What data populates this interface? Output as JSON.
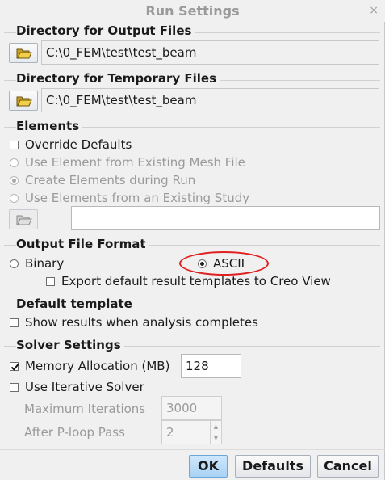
{
  "window": {
    "title": "Run Settings",
    "close_glyph": "×"
  },
  "output_dir": {
    "group_title": "Directory for Output Files",
    "path": "C:\\0_FEM\\test\\test_beam",
    "icon": "folder-open-icon"
  },
  "temp_dir": {
    "group_title": "Directory for Temporary Files",
    "path": "C:\\0_FEM\\test\\test_beam",
    "icon": "folder-open-icon"
  },
  "elements": {
    "group_title": "Elements",
    "override_defaults": {
      "label": "Override Defaults",
      "checked": false
    },
    "options": [
      {
        "label": "Use Element from Existing Mesh File",
        "selected": false,
        "enabled": false
      },
      {
        "label": "Create Elements during Run",
        "selected": true,
        "enabled": false
      },
      {
        "label": "Use Elements from an Existing Study",
        "selected": false,
        "enabled": false
      }
    ],
    "study_path": ""
  },
  "output_format": {
    "group_title": "Output File Format",
    "binary_label": "Binary",
    "ascii_label": "ASCII",
    "selected": "ASCII",
    "export_templates": {
      "label": "Export default result templates to Creo View",
      "checked": false
    }
  },
  "default_template": {
    "group_title": "Default template",
    "show_results": {
      "label": "Show results when analysis completes",
      "checked": false
    }
  },
  "solver": {
    "group_title": "Solver Settings",
    "memory_allocation": {
      "label": "Memory Allocation (MB)",
      "checked": true,
      "value": "128"
    },
    "iterative_solver": {
      "label": "Use Iterative Solver",
      "checked": false
    },
    "max_iterations": {
      "label": "Maximum  Iterations",
      "value": "3000"
    },
    "after_ploop": {
      "label": "After P-loop Pass",
      "value": "2"
    }
  },
  "buttons": {
    "ok": "OK",
    "defaults": "Defaults",
    "cancel": "Cancel"
  },
  "colors": {
    "annotation": "#e02020",
    "ok_button": "#a9d2f5"
  }
}
